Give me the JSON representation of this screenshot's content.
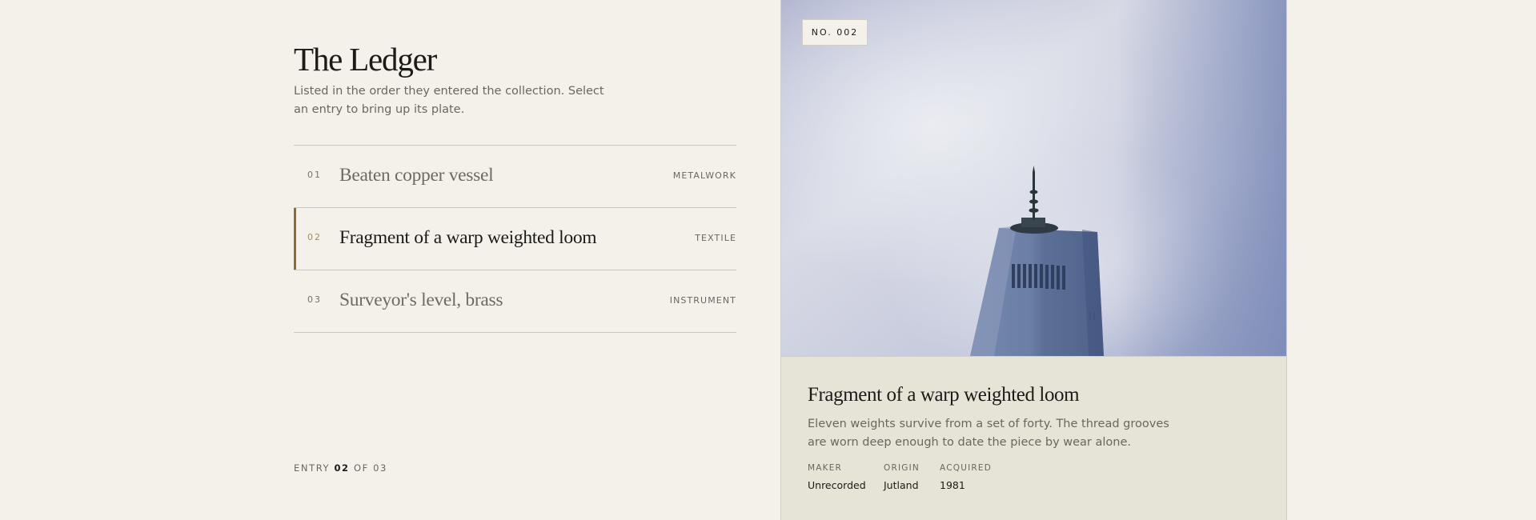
{
  "header": {
    "title": "The Ledger",
    "subtitle": "Listed in the order they entered the collection. Select an entry to bring up its plate."
  },
  "entries": [
    {
      "number": "01",
      "name": "Beaten copper vessel",
      "category": "METALWORK",
      "active": false
    },
    {
      "number": "02",
      "name": "Fragment of a warp weighted loom",
      "category": "TEXTILE",
      "active": true
    },
    {
      "number": "03",
      "name": "Surveyor's level, brass",
      "category": "INSTRUMENT",
      "active": false
    }
  ],
  "counter": {
    "prefix": "ENTRY",
    "current": "02",
    "separator": "OF",
    "total": "03"
  },
  "plate": {
    "badge": "NO. 002",
    "image_subject": "glass skyscraper with spire against cloudy blue sky"
  },
  "detail": {
    "title": "Fragment of a warp weighted loom",
    "description": "Eleven weights survive from a set of forty. The thread grooves are worn deep enough to date the piece by wear alone.",
    "meta": [
      {
        "label": "MAKER",
        "value": "Unrecorded"
      },
      {
        "label": "ORIGIN",
        "value": "Jutland"
      },
      {
        "label": "ACQUIRED",
        "value": "1981"
      }
    ]
  },
  "colors": {
    "background": "#f4f1eb",
    "accent": "#8b6a3c",
    "detail_panel": "#e6e3d7",
    "text_primary": "#1c1a17",
    "text_muted": "#6b6660"
  }
}
